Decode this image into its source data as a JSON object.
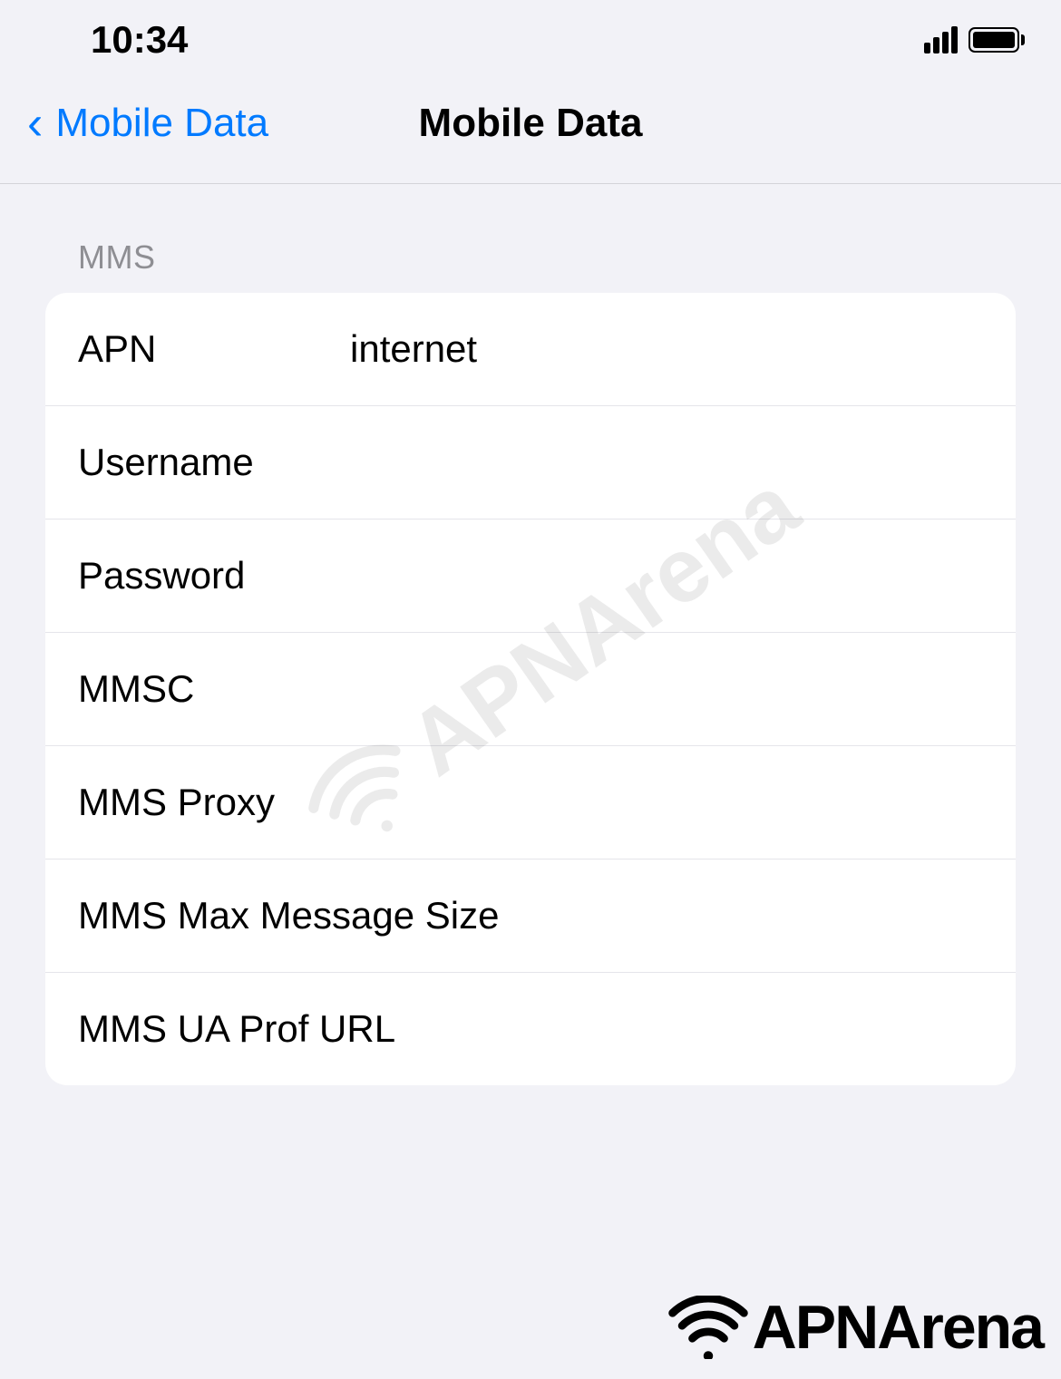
{
  "statusBar": {
    "time": "10:34"
  },
  "navBar": {
    "backLabel": "Mobile Data",
    "title": "Mobile Data"
  },
  "section": {
    "header": "MMS",
    "rows": [
      {
        "label": "APN",
        "value": "internet"
      },
      {
        "label": "Username",
        "value": ""
      },
      {
        "label": "Password",
        "value": ""
      },
      {
        "label": "MMSC",
        "value": ""
      },
      {
        "label": "MMS Proxy",
        "value": ""
      },
      {
        "label": "MMS Max Message Size",
        "value": ""
      },
      {
        "label": "MMS UA Prof URL",
        "value": ""
      }
    ]
  },
  "watermark": {
    "text": "APNArena"
  },
  "footer": {
    "logo": "APNArena"
  }
}
